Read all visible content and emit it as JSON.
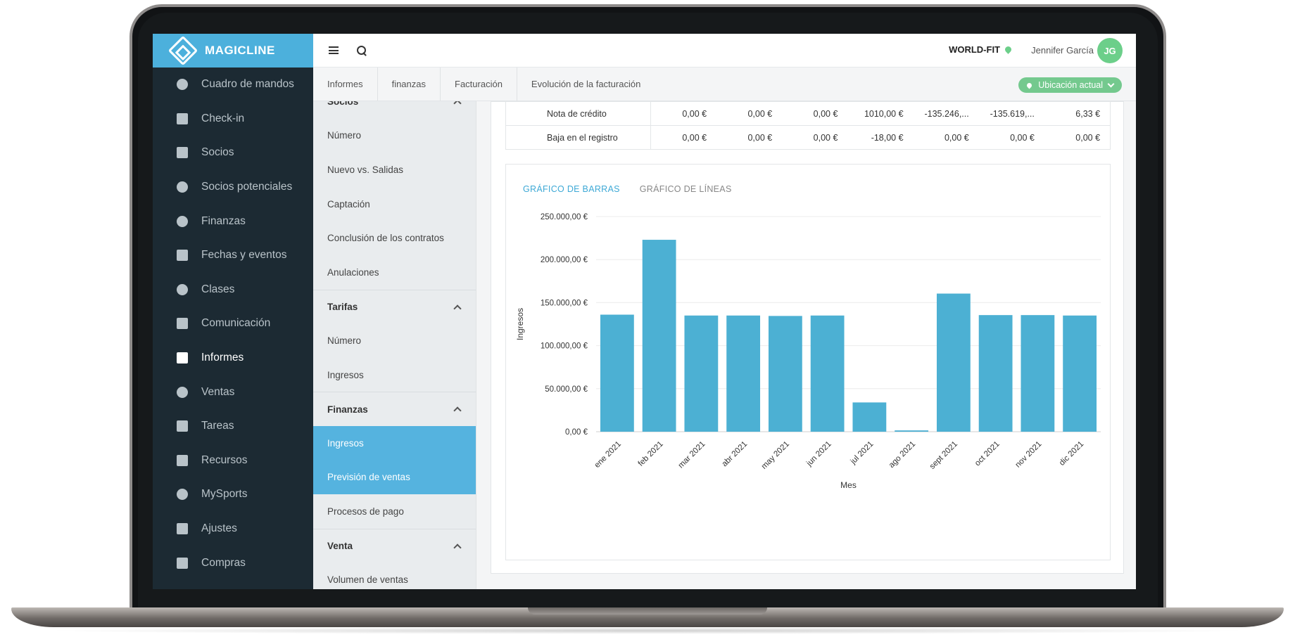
{
  "app": {
    "logo": "MAGICLINE"
  },
  "sidebar": {
    "items": [
      {
        "label": "Cuadro de mandos",
        "icon": "gauge-icon"
      },
      {
        "label": "Check-in",
        "icon": "sign-in-icon"
      },
      {
        "label": "Socios",
        "icon": "id-card-icon"
      },
      {
        "label": "Socios potenciales",
        "icon": "target-icon"
      },
      {
        "label": "Finanzas",
        "icon": "euro-icon"
      },
      {
        "label": "Fechas y eventos",
        "icon": "calendar-icon"
      },
      {
        "label": "Clases",
        "icon": "stopwatch-icon"
      },
      {
        "label": "Comunicación",
        "icon": "chat-icon"
      },
      {
        "label": "Informes",
        "icon": "chart-area-icon",
        "active": true
      },
      {
        "label": "Ventas",
        "icon": "cart-icon"
      },
      {
        "label": "Tareas",
        "icon": "check-square-icon"
      },
      {
        "label": "Recursos",
        "icon": "users-icon"
      },
      {
        "label": "MySports",
        "icon": "dots-grid-icon"
      },
      {
        "label": "Ajustes",
        "icon": "sliders-icon"
      },
      {
        "label": "Compras",
        "icon": "store-icon"
      }
    ]
  },
  "header": {
    "location": "WORLD-FIT",
    "user": "Jennifer García",
    "avatar": "JG"
  },
  "breadcrumb": [
    "Informes",
    "finanzas",
    "Facturación",
    "Evolución de la facturación"
  ],
  "location_button": "Ubicación actual",
  "submenu": {
    "groups": [
      {
        "title": "Socios",
        "items": [
          "Número",
          "Nuevo vs. Salidas",
          "Captación",
          "Conclusión de los contratos",
          "Anulaciones"
        ]
      },
      {
        "title": "Tarifas",
        "items": [
          "Número",
          "Ingresos"
        ]
      },
      {
        "title": "Finanzas",
        "items": [
          "Ingresos",
          "Previsión de ventas",
          "Procesos de pago"
        ],
        "selected": [
          0,
          1
        ]
      },
      {
        "title": "Venta",
        "items": [
          "Volumen de ventas"
        ]
      }
    ]
  },
  "table": {
    "rows": [
      {
        "label": "Nota de crédito",
        "cells": [
          "0,00 €",
          "0,00 €",
          "0,00 €",
          "1010,00 €",
          "-135.246,...",
          "-135.619,...",
          "6,33 €"
        ]
      },
      {
        "label": "Baja en el registro",
        "cells": [
          "0,00 €",
          "0,00 €",
          "0,00 €",
          "-18,00 €",
          "0,00 €",
          "0,00 €",
          "0,00 €"
        ]
      }
    ]
  },
  "chart_tabs": [
    "GRÁFICO DE BARRAS",
    "GRÁFICO DE LÍNEAS"
  ],
  "colors": {
    "accent": "#4cb0dc",
    "bar": "#4cb0d3",
    "green": "#6ccf8a",
    "sidebar": "#1c2a33"
  },
  "chart_data": {
    "type": "bar",
    "categories": [
      "ene 2021",
      "feb 2021",
      "mar 2021",
      "abr 2021",
      "may 2021",
      "jun 2021",
      "jul 2021",
      "ago 2021",
      "sept 2021",
      "oct 2021",
      "nov 2021",
      "dic 2021"
    ],
    "values": [
      136000,
      223000,
      135000,
      135000,
      134500,
      135000,
      34000,
      1500,
      160500,
      135500,
      135500,
      135000
    ],
    "xlabel": "Mes",
    "ylabel": "Ingresos",
    "ylim": [
      0,
      250000
    ],
    "yticks": [
      "0,00 €",
      "50.000,00 €",
      "100.000,00 €",
      "150.000,00 €",
      "200.000,00 €",
      "250.000,00 €"
    ],
    "grid": true
  }
}
